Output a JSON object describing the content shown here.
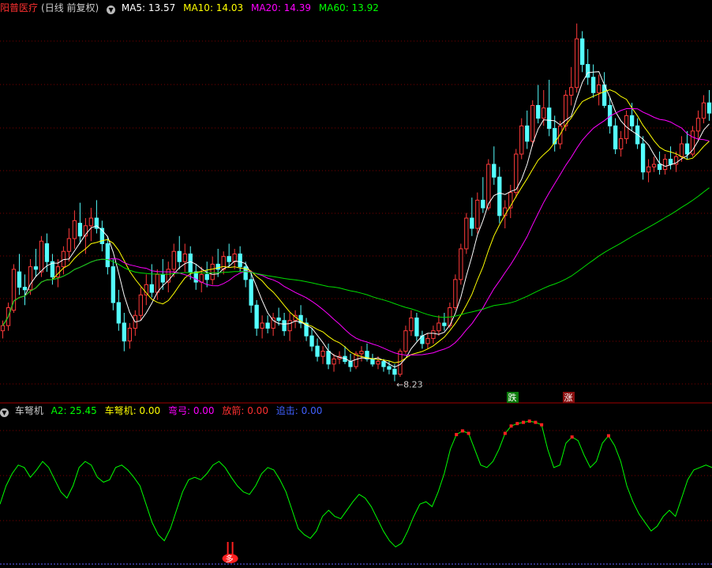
{
  "main": {
    "title": "阳普医疗",
    "period": "(日线 前复权)",
    "ma": [
      {
        "label": "MA5: 13.57",
        "color": "#ffffff"
      },
      {
        "label": "MA10: 14.03",
        "color": "#ffff00"
      },
      {
        "label": "MA20: 14.39",
        "color": "#ff00ff"
      },
      {
        "label": "MA60: 13.92",
        "color": "#00ff00"
      }
    ],
    "low_label": "←8.23",
    "down_badge": "跌",
    "up_badge": "涨"
  },
  "indicator": {
    "name": "车弩机",
    "fields": [
      {
        "label": "A2: 25.45",
        "color": "#00ff00"
      },
      {
        "label": "车弩机: 0.00",
        "color": "#ffff00"
      },
      {
        "label": "弯弓: 0.00",
        "color": "#ff00ff"
      },
      {
        "label": "放箭: 0.00",
        "color": "#ff3030"
      },
      {
        "label": "追击: 0.00",
        "color": "#4060ff"
      }
    ],
    "signal_label": "多"
  },
  "colors": {
    "up": "#ff3a3a",
    "down": "#54ffff",
    "grid": "#7a0000",
    "a2": "#00ff00",
    "ma60": "#00dd00"
  },
  "chart_data": [
    {
      "type": "candlestick",
      "ylim": [
        8.0,
        22.5
      ],
      "candles": [
        [
          10.2,
          10.6,
          9.9,
          10.4
        ],
        [
          10.4,
          11.3,
          10.2,
          11.1
        ],
        [
          11.0,
          12.8,
          10.9,
          12.6
        ],
        [
          12.5,
          13.2,
          11.6,
          11.9
        ],
        [
          11.9,
          12.4,
          11.2,
          11.8
        ],
        [
          11.8,
          13.0,
          11.6,
          12.7
        ],
        [
          12.7,
          13.4,
          12.3,
          12.6
        ],
        [
          12.5,
          13.9,
          12.3,
          13.7
        ],
        [
          13.6,
          14.0,
          12.5,
          12.9
        ],
        [
          12.9,
          13.2,
          12.0,
          12.3
        ],
        [
          12.3,
          13.0,
          11.9,
          12.7
        ],
        [
          12.7,
          13.5,
          12.4,
          13.3
        ],
        [
          13.3,
          14.2,
          12.9,
          13.8
        ],
        [
          13.8,
          14.9,
          13.4,
          14.5
        ],
        [
          14.4,
          15.2,
          13.6,
          13.9
        ],
        [
          13.9,
          14.6,
          13.2,
          14.3
        ],
        [
          14.3,
          15.0,
          13.7,
          14.6
        ],
        [
          14.6,
          15.3,
          14.0,
          14.2
        ],
        [
          14.2,
          14.5,
          13.3,
          13.6
        ],
        [
          13.6,
          13.9,
          12.4,
          12.7
        ],
        [
          12.7,
          13.0,
          11.0,
          11.3
        ],
        [
          11.3,
          11.8,
          10.2,
          10.5
        ],
        [
          10.5,
          10.9,
          9.4,
          9.8
        ],
        [
          9.8,
          10.5,
          9.5,
          10.3
        ],
        [
          10.3,
          11.0,
          10.0,
          10.8
        ],
        [
          10.8,
          11.9,
          10.6,
          11.6
        ],
        [
          11.6,
          12.4,
          11.2,
          12.0
        ],
        [
          12.0,
          12.8,
          11.5,
          11.7
        ],
        [
          11.7,
          12.6,
          11.4,
          12.4
        ],
        [
          12.4,
          13.0,
          11.8,
          12.1
        ],
        [
          12.1,
          12.9,
          11.7,
          12.6
        ],
        [
          12.6,
          13.6,
          12.3,
          13.3
        ],
        [
          13.3,
          13.9,
          12.6,
          12.9
        ],
        [
          12.9,
          13.6,
          12.5,
          13.2
        ],
        [
          13.2,
          13.5,
          12.2,
          12.5
        ],
        [
          12.5,
          12.8,
          11.8,
          12.1
        ],
        [
          12.1,
          12.7,
          11.7,
          12.4
        ],
        [
          12.4,
          12.9,
          11.9,
          12.2
        ],
        [
          12.2,
          13.1,
          12.0,
          12.8
        ],
        [
          12.8,
          13.4,
          12.3,
          12.6
        ],
        [
          12.6,
          13.3,
          12.4,
          13.1
        ],
        [
          13.1,
          13.6,
          12.7,
          12.9
        ],
        [
          12.9,
          13.4,
          12.6,
          13.2
        ],
        [
          13.2,
          13.5,
          12.5,
          12.7
        ],
        [
          12.7,
          12.9,
          11.9,
          12.2
        ],
        [
          12.2,
          12.5,
          10.9,
          11.2
        ],
        [
          11.2,
          11.4,
          10.0,
          10.3
        ],
        [
          10.3,
          10.8,
          9.9,
          10.5
        ],
        [
          10.5,
          10.8,
          10.1,
          10.3
        ],
        [
          10.3,
          10.9,
          10.0,
          10.7
        ],
        [
          10.7,
          11.1,
          10.4,
          10.6
        ],
        [
          10.6,
          10.9,
          10.0,
          10.2
        ],
        [
          10.2,
          10.9,
          9.8,
          10.6
        ],
        [
          10.6,
          11.0,
          10.3,
          10.8
        ],
        [
          10.8,
          11.2,
          10.3,
          10.5
        ],
        [
          10.5,
          10.7,
          9.8,
          10.0
        ],
        [
          10.0,
          10.3,
          9.4,
          9.6
        ],
        [
          9.6,
          9.9,
          9.0,
          9.2
        ],
        [
          9.2,
          9.6,
          8.9,
          9.4
        ],
        [
          9.4,
          9.7,
          8.7,
          8.9
        ],
        [
          8.9,
          9.3,
          8.6,
          9.1
        ],
        [
          9.1,
          9.4,
          8.9,
          9.2
        ],
        [
          9.2,
          9.6,
          8.9,
          9.0
        ],
        [
          9.0,
          9.3,
          8.6,
          8.8
        ],
        [
          8.8,
          9.4,
          8.7,
          9.3
        ],
        [
          9.3,
          9.6,
          9.0,
          9.4
        ],
        [
          9.4,
          9.7,
          9.0,
          9.1
        ],
        [
          9.1,
          9.3,
          8.8,
          8.9
        ],
        [
          8.9,
          9.2,
          8.7,
          9.0
        ],
        [
          9.0,
          9.1,
          8.6,
          8.8
        ],
        [
          8.8,
          9.0,
          8.5,
          8.7
        ],
        [
          8.7,
          8.9,
          8.23,
          8.5
        ],
        [
          8.5,
          9.5,
          8.4,
          9.4
        ],
        [
          9.4,
          10.4,
          9.3,
          10.2
        ],
        [
          10.2,
          11.0,
          10.0,
          10.7
        ],
        [
          10.7,
          10.9,
          9.8,
          10.0
        ],
        [
          10.0,
          10.2,
          9.5,
          9.7
        ],
        [
          9.7,
          10.1,
          9.5,
          9.9
        ],
        [
          9.9,
          10.4,
          9.7,
          10.2
        ],
        [
          10.2,
          10.8,
          10.0,
          10.5
        ],
        [
          10.5,
          10.9,
          10.2,
          10.4
        ],
        [
          10.4,
          11.3,
          10.3,
          11.1
        ],
        [
          11.1,
          12.4,
          11.0,
          12.2
        ],
        [
          12.2,
          13.6,
          12.0,
          13.4
        ],
        [
          13.4,
          14.8,
          13.2,
          14.6
        ],
        [
          14.6,
          15.4,
          13.9,
          14.2
        ],
        [
          14.2,
          15.6,
          14.0,
          15.3
        ],
        [
          15.3,
          16.2,
          14.8,
          15.0
        ],
        [
          15.0,
          16.9,
          14.9,
          16.7
        ],
        [
          16.7,
          17.4,
          15.9,
          16.2
        ],
        [
          16.2,
          16.6,
          14.4,
          14.7
        ],
        [
          14.7,
          15.3,
          14.2,
          15.0
        ],
        [
          15.0,
          15.9,
          14.6,
          15.6
        ],
        [
          15.6,
          17.3,
          15.4,
          17.1
        ],
        [
          17.1,
          18.5,
          16.9,
          18.2
        ],
        [
          18.2,
          18.8,
          17.3,
          17.6
        ],
        [
          17.6,
          19.2,
          17.4,
          19.0
        ],
        [
          19.0,
          19.8,
          18.3,
          18.5
        ],
        [
          18.5,
          19.6,
          18.2,
          18.9
        ],
        [
          18.9,
          20.0,
          17.8,
          18.1
        ],
        [
          18.1,
          18.6,
          17.2,
          17.5
        ],
        [
          17.5,
          18.4,
          17.3,
          18.2
        ],
        [
          18.2,
          19.6,
          18.0,
          19.4
        ],
        [
          19.4,
          20.5,
          19.0,
          19.7
        ],
        [
          19.7,
          22.2,
          19.5,
          21.6
        ],
        [
          21.6,
          21.9,
          20.3,
          20.6
        ],
        [
          20.6,
          21.2,
          19.8,
          20.1
        ],
        [
          20.1,
          20.6,
          19.3,
          19.5
        ],
        [
          19.5,
          20.2,
          19.0,
          19.8
        ],
        [
          19.8,
          20.3,
          18.9,
          19.0
        ],
        [
          19.0,
          19.3,
          17.9,
          18.2
        ],
        [
          18.2,
          18.5,
          17.1,
          17.3
        ],
        [
          17.3,
          18.0,
          17.0,
          17.7
        ],
        [
          17.7,
          18.8,
          17.5,
          18.6
        ],
        [
          18.6,
          19.1,
          18.0,
          18.2
        ],
        [
          18.2,
          18.5,
          17.3,
          17.5
        ],
        [
          17.5,
          17.8,
          16.1,
          16.4
        ],
        [
          16.4,
          16.9,
          16.0,
          16.6
        ],
        [
          16.6,
          17.0,
          16.4,
          16.7
        ],
        [
          16.7,
          17.2,
          16.3,
          16.5
        ],
        [
          16.5,
          17.1,
          16.3,
          16.9
        ],
        [
          16.9,
          17.4,
          16.5,
          16.7
        ],
        [
          16.7,
          17.2,
          16.4,
          17.0
        ],
        [
          17.0,
          17.8,
          16.8,
          17.5
        ],
        [
          17.5,
          18.0,
          16.9,
          17.1
        ],
        [
          17.1,
          18.2,
          17.0,
          18.0
        ],
        [
          18.0,
          18.8,
          17.6,
          18.5
        ],
        [
          18.5,
          19.4,
          18.3,
          19.1
        ],
        [
          19.1,
          19.6,
          18.4,
          18.7
        ]
      ],
      "ma_periods": [
        5,
        10,
        20,
        60
      ]
    },
    {
      "type": "line",
      "series": [
        {
          "name": "A2",
          "values": [
            40,
            55,
            65,
            72,
            70,
            62,
            68,
            75,
            70,
            60,
            50,
            45,
            55,
            70,
            75,
            72,
            62,
            58,
            60,
            70,
            72,
            68,
            62,
            55,
            40,
            25,
            15,
            10,
            20,
            35,
            50,
            60,
            62,
            60,
            65,
            72,
            75,
            70,
            62,
            55,
            50,
            48,
            55,
            65,
            70,
            68,
            60,
            50,
            35,
            20,
            15,
            12,
            18,
            30,
            35,
            30,
            28,
            35,
            42,
            48,
            45,
            38,
            28,
            18,
            10,
            5,
            8,
            18,
            30,
            40,
            42,
            38,
            50,
            65,
            85,
            97,
            100,
            98,
            85,
            72,
            70,
            75,
            85,
            98,
            104,
            106,
            107,
            108,
            107,
            105,
            85,
            70,
            72,
            90,
            95,
            92,
            80,
            70,
            75,
            90,
            96,
            88,
            75,
            55,
            42,
            32,
            25,
            18,
            22,
            30,
            35,
            30,
            45,
            60,
            68,
            70,
            72,
            70
          ]
        }
      ],
      "signal_index": [
        22
      ]
    }
  ]
}
